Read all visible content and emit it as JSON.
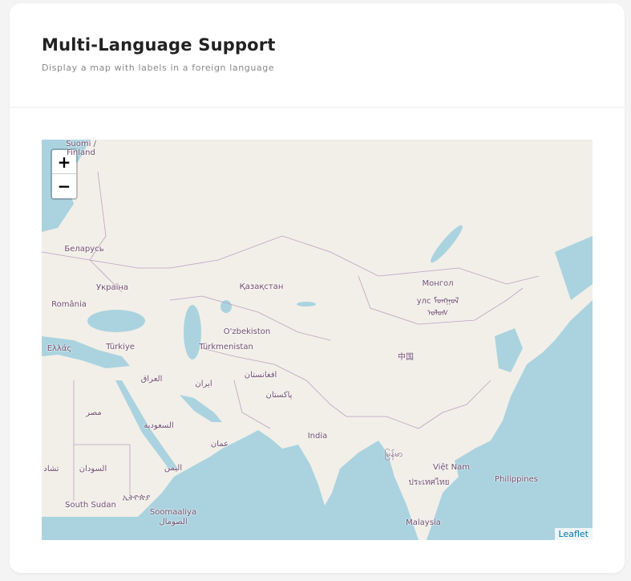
{
  "header": {
    "title": "Multi-Language Support",
    "subtitle": "Display a map with labels in a foreign language"
  },
  "map": {
    "colors": {
      "land": "#f2efe9",
      "water": "#aad3df",
      "border": "#b9a3c0",
      "label": "#6f4d6f"
    },
    "zoom_in": "+",
    "zoom_out": "−",
    "attribution": "Leaflet",
    "labels": [
      {
        "text": "Suomi /",
        "name": "finland"
      },
      {
        "text": "Finland",
        "name": "finland-en"
      },
      {
        "text": "Беларусь",
        "name": "belarus"
      },
      {
        "text": "Україна",
        "name": "ukraine"
      },
      {
        "text": "România",
        "name": "romania"
      },
      {
        "text": "Ελλάς",
        "name": "greece"
      },
      {
        "text": "Türkiye",
        "name": "turkey"
      },
      {
        "text": "Қазақстан",
        "name": "kazakhstan"
      },
      {
        "text": "O'zbekiston",
        "name": "uzbekistan"
      },
      {
        "text": "Türkmenistan",
        "name": "turkmenistan"
      },
      {
        "text": "Монгол",
        "name": "mongolia"
      },
      {
        "text": "улс ᠮᠣᠩᠭᠣᠯ",
        "name": "mongolia-2"
      },
      {
        "text": "ᠤᠯᠤᠰ",
        "name": "mongolia-3"
      },
      {
        "text": "中国",
        "name": "china"
      },
      {
        "text": "العراق",
        "name": "iraq"
      },
      {
        "text": "ایران",
        "name": "iran"
      },
      {
        "text": "افغانستان",
        "name": "afghanistan"
      },
      {
        "text": "پاکستان",
        "name": "pakistan"
      },
      {
        "text": "مصر",
        "name": "egypt"
      },
      {
        "text": "السعودية",
        "name": "saudi-arabia"
      },
      {
        "text": "عمان",
        "name": "oman"
      },
      {
        "text": "India",
        "name": "india"
      },
      {
        "text": "اليمن",
        "name": "yemen"
      },
      {
        "text": "السودان",
        "name": "sudan"
      },
      {
        "text": "تشاد",
        "name": "chad"
      },
      {
        "text": "South Sudan",
        "name": "south-sudan"
      },
      {
        "text": "ኢትዮጵያ",
        "name": "ethiopia"
      },
      {
        "text": "Soomaaliya",
        "name": "somalia"
      },
      {
        "text": "الصومال",
        "name": "somalia-ar"
      },
      {
        "text": "မြန်မာ",
        "name": "myanmar"
      },
      {
        "text": "Việt Nam",
        "name": "vietnam"
      },
      {
        "text": "ประเทศไทย",
        "name": "thailand"
      },
      {
        "text": "Philippines",
        "name": "philippines"
      },
      {
        "text": "Malaysia",
        "name": "malaysia"
      }
    ]
  }
}
